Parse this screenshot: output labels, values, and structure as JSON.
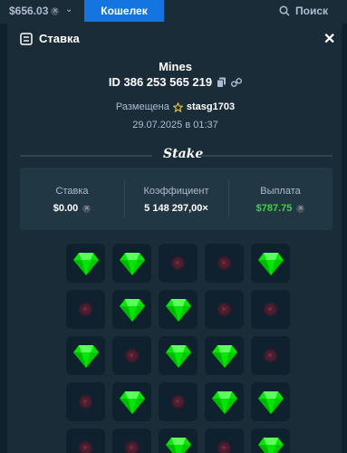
{
  "topbar": {
    "balance": "$656.03",
    "wallet_label": "Кошелек",
    "search_label": "Поиск"
  },
  "modal": {
    "title": "Ставка"
  },
  "bet": {
    "game": "Mines",
    "id": "ID 386 253 565 219",
    "placed_by_label": "Размещена",
    "user": "stasg1703",
    "date": "29.07.2025 в 01:37"
  },
  "brand": "Stake",
  "stats": {
    "bet_label": "Ставка",
    "bet_value": "$0.00",
    "multiplier_label": "Коэффициент",
    "multiplier_value": "5 148 297,00×",
    "payout_label": "Выплата",
    "payout_value": "$787.75"
  },
  "colors": {
    "gem": "#00e701",
    "payout": "#3dd63d",
    "accent": "#1475e1"
  },
  "board": [
    [
      "gem",
      "gem",
      "mine",
      "mine",
      "gem"
    ],
    [
      "mine",
      "gem",
      "gem",
      "mine",
      "mine"
    ],
    [
      "gem",
      "mine",
      "gem",
      "gem",
      "mine"
    ],
    [
      "mine",
      "gem",
      "mine",
      "gem",
      "gem"
    ],
    [
      "mine",
      "mine",
      "gem",
      "mine",
      "gem"
    ]
  ]
}
